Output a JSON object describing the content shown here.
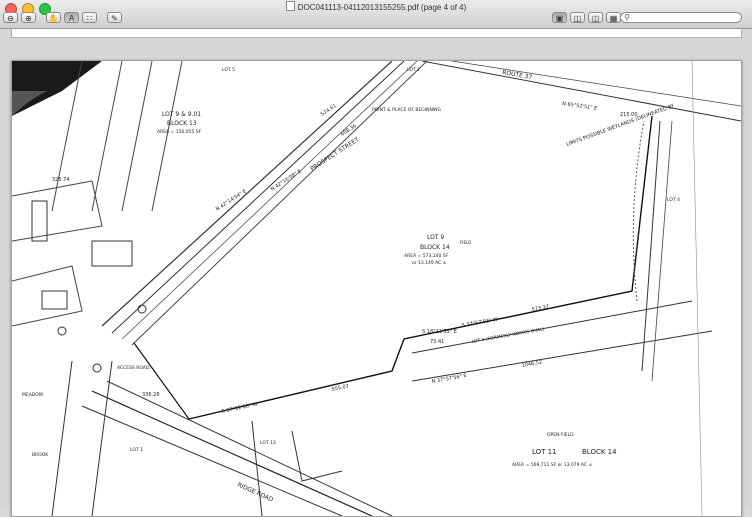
{
  "window": {
    "title": "DOC041113-04112013155255.pdf (page 4 of 4)",
    "traffic_lights": [
      "#ff5f57",
      "#febc2e",
      "#28c840"
    ]
  },
  "toolbar": {
    "zoom_out_icon": "zoom-out-icon",
    "zoom_in_icon": "zoom-in-icon",
    "hand_icon": "hand-icon",
    "text_select_label": "A",
    "rect_select_icon": "rect-select-icon",
    "annotate_icon": "pencil-icon",
    "view_buttons": [
      "single-page-icon",
      "sidebar-icon",
      "two-page-icon",
      "contact-sheet-icon"
    ],
    "search_placeholder": ""
  },
  "map": {
    "streets": {
      "route": "ROUTE 37",
      "prospect": "PROSPECT STREET",
      "ridge": "RIDGE ROAD",
      "access": "ACCESS ROAD"
    },
    "lots": {
      "lot9b": "LOT 9 & 9.01",
      "lot9b_block": "BLOCK 13",
      "lot9b_area": "AREA = 156,055 SF",
      "lot9": "LOT 9",
      "block14": "BLOCK 14",
      "lot9_area": "AREA = 573,140 SF",
      "lot9_area2": "or 13.149 AC ±",
      "lot11": "LOT 11",
      "block14b": "BLOCK 14",
      "lot11_area": "AREA = 569,711 SF or 13.079 AC ±",
      "lot3": "LOT 3 (FORMERLY NORRIS OVAL)",
      "lot13": "LOT 13",
      "lot1": "LOT 1",
      "lot1_top": "LOT 1",
      "lot4": "LOT 4",
      "lot5": "LOT 5"
    },
    "bearings": {
      "prospect1": "N 42°14'54\" E",
      "prospect2": "N 42°16'08\" E",
      "b_south": "S 37°52'08\" W",
      "b_mid": "S 37°57'03\" W",
      "b_lower": "N 37°57'56\" E",
      "b_short": "S 18°11'53\" E",
      "b_top": "N 65°52'51\" E"
    },
    "distances": {
      "d1": "524.61",
      "d2": "608.36",
      "d3": "555.07",
      "d4": "573.37",
      "d5": "1046.52",
      "d6": "73.41",
      "d7": "215.00",
      "d8": "336.26",
      "d9": "325.74"
    },
    "notes": {
      "pob": "POINT & PLACE OF BEGINNING",
      "wetland": "LIMITS POSSIBLE WETLANDS (DELINEATED BY",
      "meadow": "MEADOW",
      "field": "FIELD",
      "open_field": "OPEN FIELD",
      "brook": "BROOK"
    }
  }
}
